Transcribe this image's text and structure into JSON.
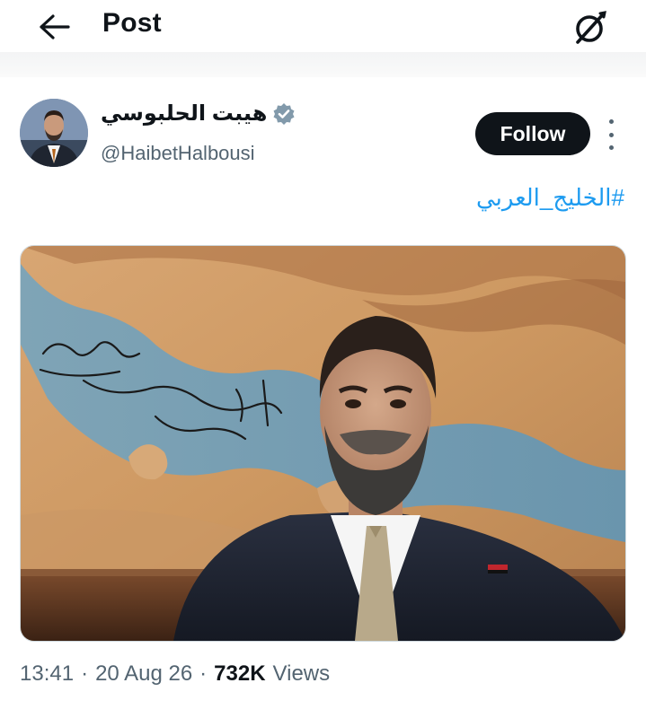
{
  "header": {
    "title": "Post",
    "back_icon": "arrow-left-icon",
    "grok_icon": "grok-slash-icon"
  },
  "author": {
    "display_name": "هيبت الحلبوسي",
    "handle": "@HaibetHalbousi",
    "verified": true,
    "verified_color": "#829aab",
    "follow_label": "Follow"
  },
  "post": {
    "hashtag": "#الخليج_العربي",
    "image_caption_calligraphy": "الخليج العربي"
  },
  "meta": {
    "time": "13:41",
    "separator": "·",
    "date": "20 Aug 26",
    "views_count": "732K",
    "views_label": "Views"
  },
  "colors": {
    "link": "#1d9bf0",
    "text_primary": "#0f1419",
    "text_secondary": "#536471",
    "follow_bg": "#0f1419"
  }
}
